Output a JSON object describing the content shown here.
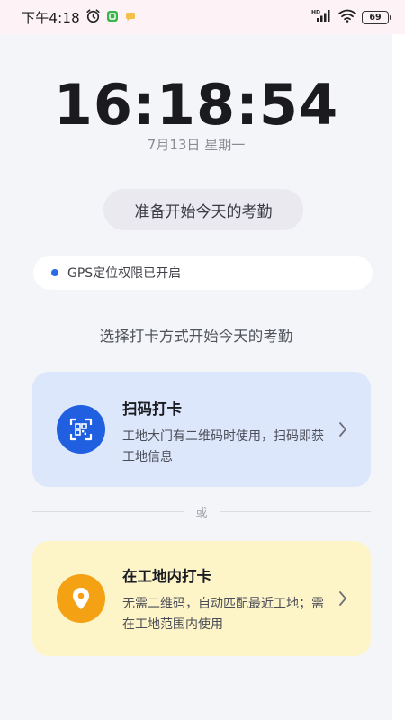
{
  "status_bar": {
    "time": "下午4:18",
    "network_label": "HD",
    "battery_level": "69"
  },
  "clock": {
    "time": "16:18:54",
    "date": "7月13日  星期一"
  },
  "ready_button_label": "准备开始今天的考勤",
  "gps_status": "GPS定位权限已开启",
  "choose_prompt": "选择打卡方式开始今天的考勤",
  "scan_card": {
    "title": "扫码打卡",
    "description": "工地大门有二维码时使用，扫码即获工地信息",
    "icon": "qr-scan-icon"
  },
  "divider_label": "或",
  "site_card": {
    "title": "在工地内打卡",
    "description": "无需二维码，自动匹配最近工地；需在工地范围内使用",
    "icon": "location-pin-icon"
  },
  "colors": {
    "accent_blue": "#1f5fe0",
    "accent_orange": "#f4a114",
    "scan_card_bg": "#dce7fb",
    "site_card_bg": "#fdf4c8",
    "gps_dot": "#2b6ae8"
  }
}
